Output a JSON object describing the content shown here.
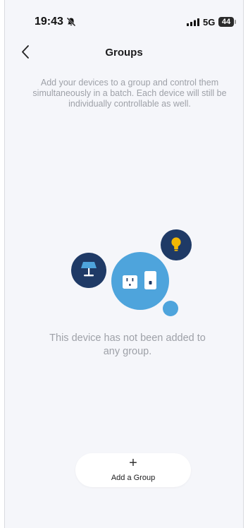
{
  "status_bar": {
    "time": "19:43",
    "network": "5G",
    "battery": "44",
    "icons": [
      "bell-slash-icon",
      "signal-icon",
      "battery-icon"
    ]
  },
  "header": {
    "title": "Groups",
    "back_icon": "chevron-left-icon"
  },
  "description": "Add your devices to a group and control them simultaneously in a batch. Each device will still be individually controllable as well.",
  "empty_state": {
    "message": "This device has not been added to any group.",
    "icons": [
      "lamp-icon",
      "bulb-icon",
      "outlet-icon",
      "switch-icon"
    ]
  },
  "add_group": {
    "icon": "plus-icon",
    "label": "Add a Group"
  },
  "colors": {
    "background": "#f5f6fa",
    "navy": "#1f3a66",
    "blue": "#4ea4dc",
    "bulb_yellow": "#f2b705",
    "text_muted": "#9ea1a8"
  }
}
